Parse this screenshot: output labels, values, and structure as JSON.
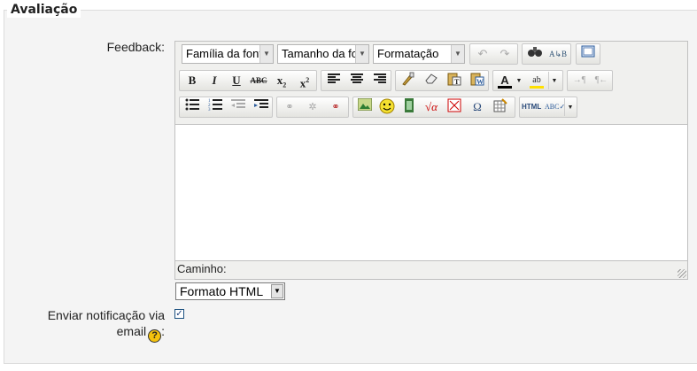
{
  "section": {
    "legend": "Avaliação"
  },
  "feedback": {
    "label": "Feedback:",
    "editor": {
      "font_family_select": "Família da font",
      "font_size_select": "Tamanho da fo",
      "format_select": "Formatação",
      "path_label": "Caminho:",
      "toolbar_row1": [
        "undo-icon",
        "redo-icon",
        "find-icon",
        "replace-icon",
        "fullscreen-icon"
      ],
      "toolbar_row2": [
        "bold-icon",
        "italic-icon",
        "underline-icon",
        "strikethrough-icon",
        "subscript-icon",
        "superscript-icon",
        "align-left-icon",
        "align-center-icon",
        "align-right-icon",
        "clean-icon",
        "eraser-icon",
        "paste-text-icon",
        "paste-word-icon",
        "text-color-icon",
        "background-color-icon",
        "ltr-icon",
        "rtl-icon"
      ],
      "toolbar_row3": [
        "bullet-list-icon",
        "numbered-list-icon",
        "outdent-icon",
        "indent-icon",
        "link-icon",
        "unlink-icon",
        "anchor-icon",
        "image-icon",
        "emoticon-icon",
        "media-icon",
        "math-icon",
        "non-breaking-icon",
        "special-char-icon",
        "table-icon",
        "html-icon",
        "spellcheck-icon"
      ]
    },
    "format_dropdown": {
      "value": "Formato HTML"
    }
  },
  "notify": {
    "label_line1": "Enviar notificação via",
    "label_line2": "email",
    "label_suffix": ":",
    "checked": true,
    "help_icon": "?"
  },
  "colors": {
    "background": "#f4f4f4",
    "border": "#dcdcdc",
    "accent_help": "#f4c20d"
  }
}
